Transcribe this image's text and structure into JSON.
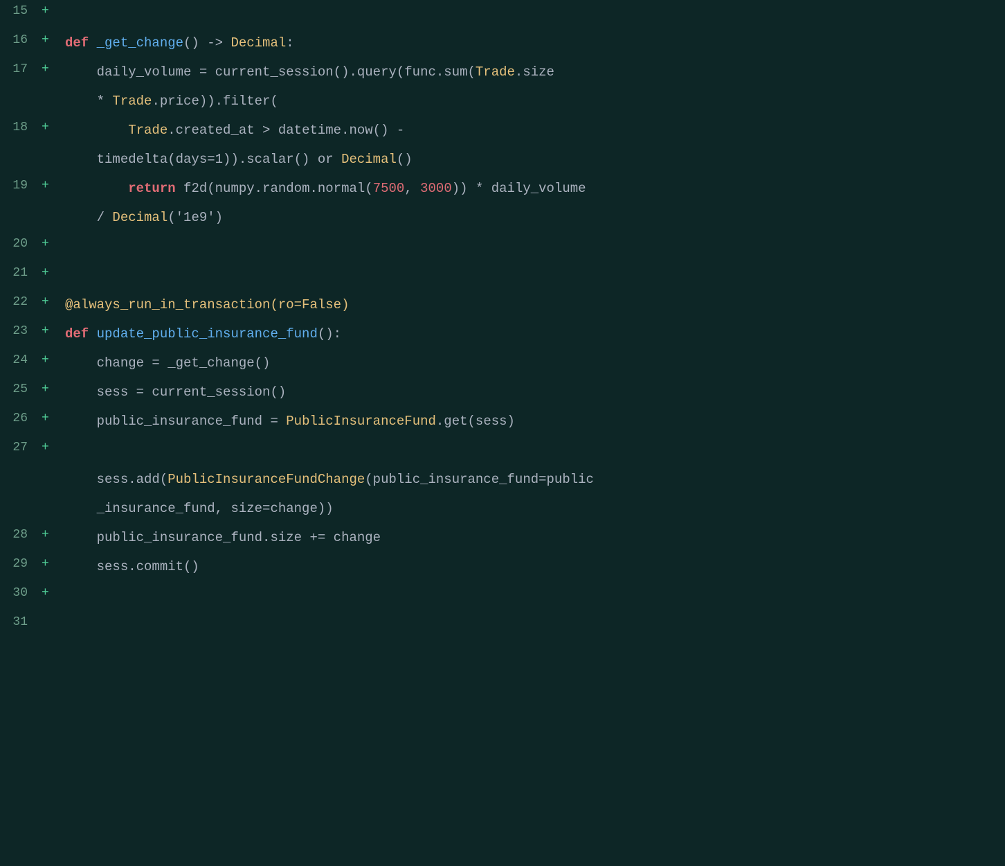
{
  "editor": {
    "background": "#0d2626",
    "lines": [
      {
        "number": "15",
        "plus": "+",
        "content": []
      },
      {
        "number": "16",
        "plus": "+",
        "content": [
          {
            "text": "def ",
            "class": "kw-def"
          },
          {
            "text": "_get_change",
            "class": "fn-name"
          },
          {
            "text": "() -> ",
            "class": "plain"
          },
          {
            "text": "Decimal",
            "class": "type-name"
          },
          {
            "text": ":",
            "class": "plain"
          }
        ]
      },
      {
        "number": "17",
        "plus": "+",
        "content": [
          {
            "text": "    daily_volume = current_session().query(func.sum(",
            "class": "plain"
          },
          {
            "text": "Trade",
            "class": "class-name"
          },
          {
            "text": ".size",
            "class": "plain"
          }
        ]
      },
      {
        "number": "",
        "plus": "",
        "content": [
          {
            "text": "    * ",
            "class": "plain"
          },
          {
            "text": "Trade",
            "class": "class-name"
          },
          {
            "text": ".price)).filter(",
            "class": "plain"
          }
        ]
      },
      {
        "number": "18",
        "plus": "+",
        "content": [
          {
            "text": "        ",
            "class": "plain"
          },
          {
            "text": "Trade",
            "class": "class-name"
          },
          {
            "text": ".created_at > datetime.now() -",
            "class": "plain"
          }
        ]
      },
      {
        "number": "",
        "plus": "",
        "content": [
          {
            "text": "    timedelta(days=1)).scalar() or ",
            "class": "plain"
          },
          {
            "text": "Decimal",
            "class": "type-name"
          },
          {
            "text": "()",
            "class": "plain"
          }
        ]
      },
      {
        "number": "19",
        "plus": "+",
        "content": [
          {
            "text": "        ",
            "class": "plain"
          },
          {
            "text": "return ",
            "class": "kw-return"
          },
          {
            "text": "f2d(numpy.random.normal(",
            "class": "plain"
          },
          {
            "text": "7500",
            "class": "number"
          },
          {
            "text": ", ",
            "class": "plain"
          },
          {
            "text": "3000",
            "class": "number"
          },
          {
            "text": ")) * daily_volume",
            "class": "plain"
          }
        ]
      },
      {
        "number": "",
        "plus": "",
        "content": [
          {
            "text": "    / ",
            "class": "plain"
          },
          {
            "text": "Decimal",
            "class": "type-name"
          },
          {
            "text": "('1e9')",
            "class": "plain"
          }
        ]
      },
      {
        "number": "20",
        "plus": "+",
        "content": []
      },
      {
        "number": "21",
        "plus": "+",
        "content": []
      },
      {
        "number": "22",
        "plus": "+",
        "content": [
          {
            "text": "@always_run_in_transaction(ro=False)",
            "class": "decorator"
          }
        ]
      },
      {
        "number": "23",
        "plus": "+",
        "content": [
          {
            "text": "def ",
            "class": "kw-def"
          },
          {
            "text": "update_public_insurance_fund",
            "class": "fn-name"
          },
          {
            "text": "():",
            "class": "plain"
          }
        ]
      },
      {
        "number": "24",
        "plus": "+",
        "content": [
          {
            "text": "    change = _get_change()",
            "class": "plain"
          }
        ]
      },
      {
        "number": "25",
        "plus": "+",
        "content": [
          {
            "text": "    sess = current_session()",
            "class": "plain"
          }
        ]
      },
      {
        "number": "26",
        "plus": "+",
        "content": [
          {
            "text": "    public_insurance_fund = ",
            "class": "plain"
          },
          {
            "text": "PublicInsuranceFund",
            "class": "class-name"
          },
          {
            "text": ".get(sess)",
            "class": "plain"
          }
        ]
      },
      {
        "number": "27",
        "plus": "+",
        "content": []
      },
      {
        "number": "",
        "plus": "",
        "content": [
          {
            "text": "    sess.add(",
            "class": "plain"
          },
          {
            "text": "PublicInsuranceFundChange",
            "class": "class-name"
          },
          {
            "text": "(public_insurance_fund=public",
            "class": "plain"
          }
        ]
      },
      {
        "number": "",
        "plus": "",
        "content": [
          {
            "text": "    _insurance_fund, size=change))",
            "class": "plain"
          }
        ]
      },
      {
        "number": "28",
        "plus": "+",
        "content": [
          {
            "text": "    public_insurance_fund.size += change",
            "class": "plain"
          }
        ]
      },
      {
        "number": "29",
        "plus": "+",
        "content": [
          {
            "text": "    sess.commit()",
            "class": "plain"
          }
        ]
      },
      {
        "number": "30",
        "plus": "+",
        "content": []
      },
      {
        "number": "31",
        "plus": "",
        "content": []
      }
    ]
  }
}
